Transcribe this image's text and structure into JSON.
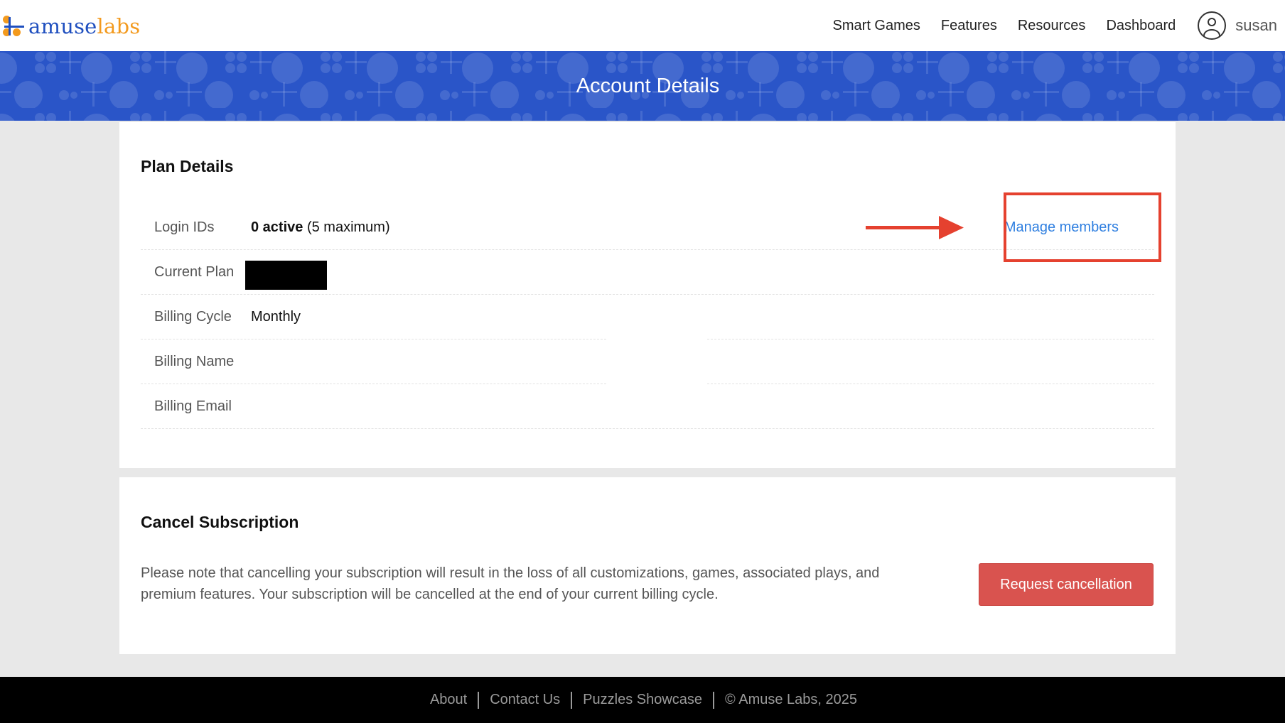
{
  "brand": {
    "logo_part1": "amuse",
    "logo_part2": "labs",
    "logo_icon": "amuse-labs-logo-icon",
    "primary_color": "#2a55c8",
    "accent_color": "#f39a1e"
  },
  "nav": {
    "links": [
      {
        "label": "Smart Games"
      },
      {
        "label": "Features"
      },
      {
        "label": "Resources"
      },
      {
        "label": "Dashboard"
      }
    ],
    "user_icon": "user-circle-icon",
    "user_name": "susan"
  },
  "banner": {
    "title": "Account Details"
  },
  "plan": {
    "title": "Plan Details",
    "rows": [
      {
        "label": "Login IDs",
        "value_bold": "0 active",
        "value_rest": " (5 maximum)"
      },
      {
        "label": "Current Plan",
        "value": ""
      },
      {
        "label": "Billing Cycle",
        "value": "Monthly"
      },
      {
        "label": "Billing Name",
        "value": ""
      },
      {
        "label": "Billing Email",
        "value": ""
      }
    ],
    "manage_link": "Manage members",
    "annotation_color": "#e5412f"
  },
  "cancel": {
    "title": "Cancel Subscription",
    "description": "Please note that cancelling your subscription will result in the loss of all customizations, games, associated plays, and premium features. Your subscription will be cancelled at the end of your current billing cycle.",
    "button_label": "Request cancellation",
    "button_color": "#d9534f"
  },
  "footer": {
    "links": [
      {
        "label": "About"
      },
      {
        "label": "Contact Us"
      },
      {
        "label": "Puzzles Showcase"
      }
    ],
    "copyright": "© Amuse Labs, 2025"
  }
}
